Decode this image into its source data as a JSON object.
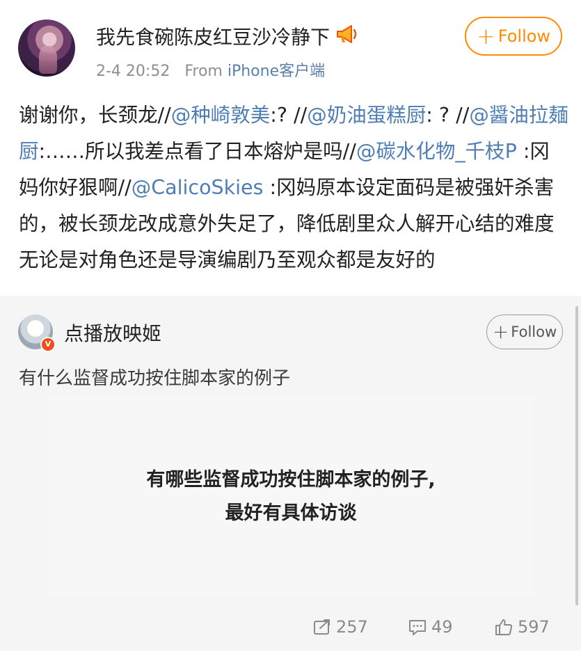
{
  "post": {
    "username": "我先食碗陈皮红豆沙冷静下",
    "time": "2-4 20:52",
    "from_label": "From",
    "source": "iPhone客户端",
    "follow_label": "Follow",
    "text_parts": [
      {
        "t": "谢谢你，长颈龙//",
        "m": false
      },
      {
        "t": "@种崎敦美",
        "m": true
      },
      {
        "t": ":? //",
        "m": false
      },
      {
        "t": "@奶油蛋糕厨",
        "m": true
      },
      {
        "t": ": ? //",
        "m": false
      },
      {
        "t": "@醤油拉麺厨",
        "m": true
      },
      {
        "t": ":……所以我差点看了日本熔炉是吗//",
        "m": false
      },
      {
        "t": "@碳水化物_千枝P",
        "m": true
      },
      {
        "t": " :冈妈你好狠啊//",
        "m": false
      },
      {
        "t": "@CalicoSkies",
        "m": true
      },
      {
        "t": " :冈妈原本设定面码是被强奸杀害的，被长颈龙改成意外失足了，降低剧里众人解开心结的难度无论是对角色还是导演编剧乃至观众都是友好的",
        "m": false
      }
    ]
  },
  "repost": {
    "username": "点播放映姬",
    "follow_label": "Follow",
    "text": "有什么监督成功按住脚本家的例子",
    "image_lines": [
      "有哪些监督成功按住脚本家的例子,",
      "最好有具体访谈"
    ],
    "verified_badge": "V"
  },
  "actions": {
    "share_count": "257",
    "comment_count": "49",
    "like_count": "597"
  },
  "colors": {
    "follow_accent": "#ff8a00",
    "mention": "#4f7eb3",
    "repost_bg": "#f5f5f5"
  }
}
